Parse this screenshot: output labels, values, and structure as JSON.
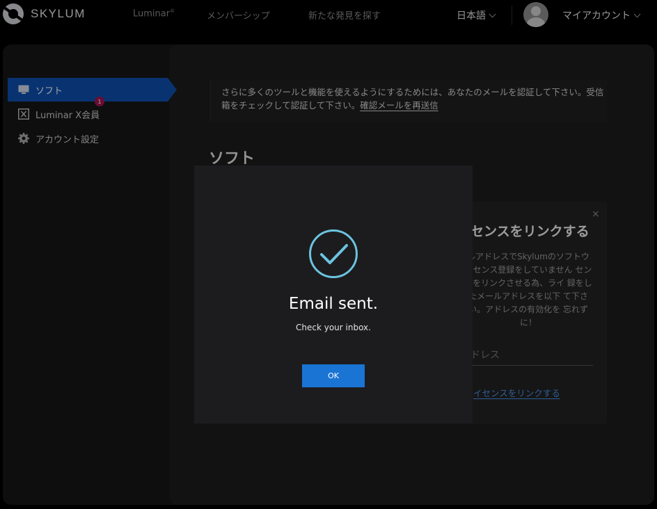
{
  "header": {
    "brand": "SKYLUM",
    "nav": [
      {
        "label": "Luminar",
        "sup": "®"
      },
      {
        "label": "メンバーシップ"
      },
      {
        "label": "新たな発見を探す"
      }
    ],
    "language": "日本語",
    "account": "マイアカウント"
  },
  "sidebar": {
    "items": [
      {
        "label": "ソフト",
        "icon": "monitor-icon",
        "active": true
      },
      {
        "label": "Luminar X会員",
        "icon": "luminar-x-icon",
        "badge": "1"
      },
      {
        "label": "アカウント設定",
        "icon": "gear-icon"
      }
    ]
  },
  "notice": {
    "text": "さらに多くのツールと機能を使えるようにするためには、あなたのメールを認証して下さい。受信箱をチェックして認証して下さい。",
    "link": "確認メールを再送信"
  },
  "main": {
    "title": "ソフト"
  },
  "card": {
    "close": "×",
    "title": "センスをリンクする",
    "body": "ルアドレスでSkylumのソフトウ イセンス登録をしていません センスをリンクさせる為、ライ 録をしたメールアドレスを以下 て下さい。アドレスの有効化を 忘れずに！",
    "input_placeholder": "ドレス",
    "link": "イセンスをリンクする"
  },
  "modal": {
    "title": "Email sent.",
    "subtitle": "Check your inbox.",
    "ok_label": "OK"
  },
  "colors": {
    "accent": "#1a74d4",
    "sidebar_active": "#0e4fad",
    "check": "#6cc3e0",
    "badge": "#a3154f"
  }
}
